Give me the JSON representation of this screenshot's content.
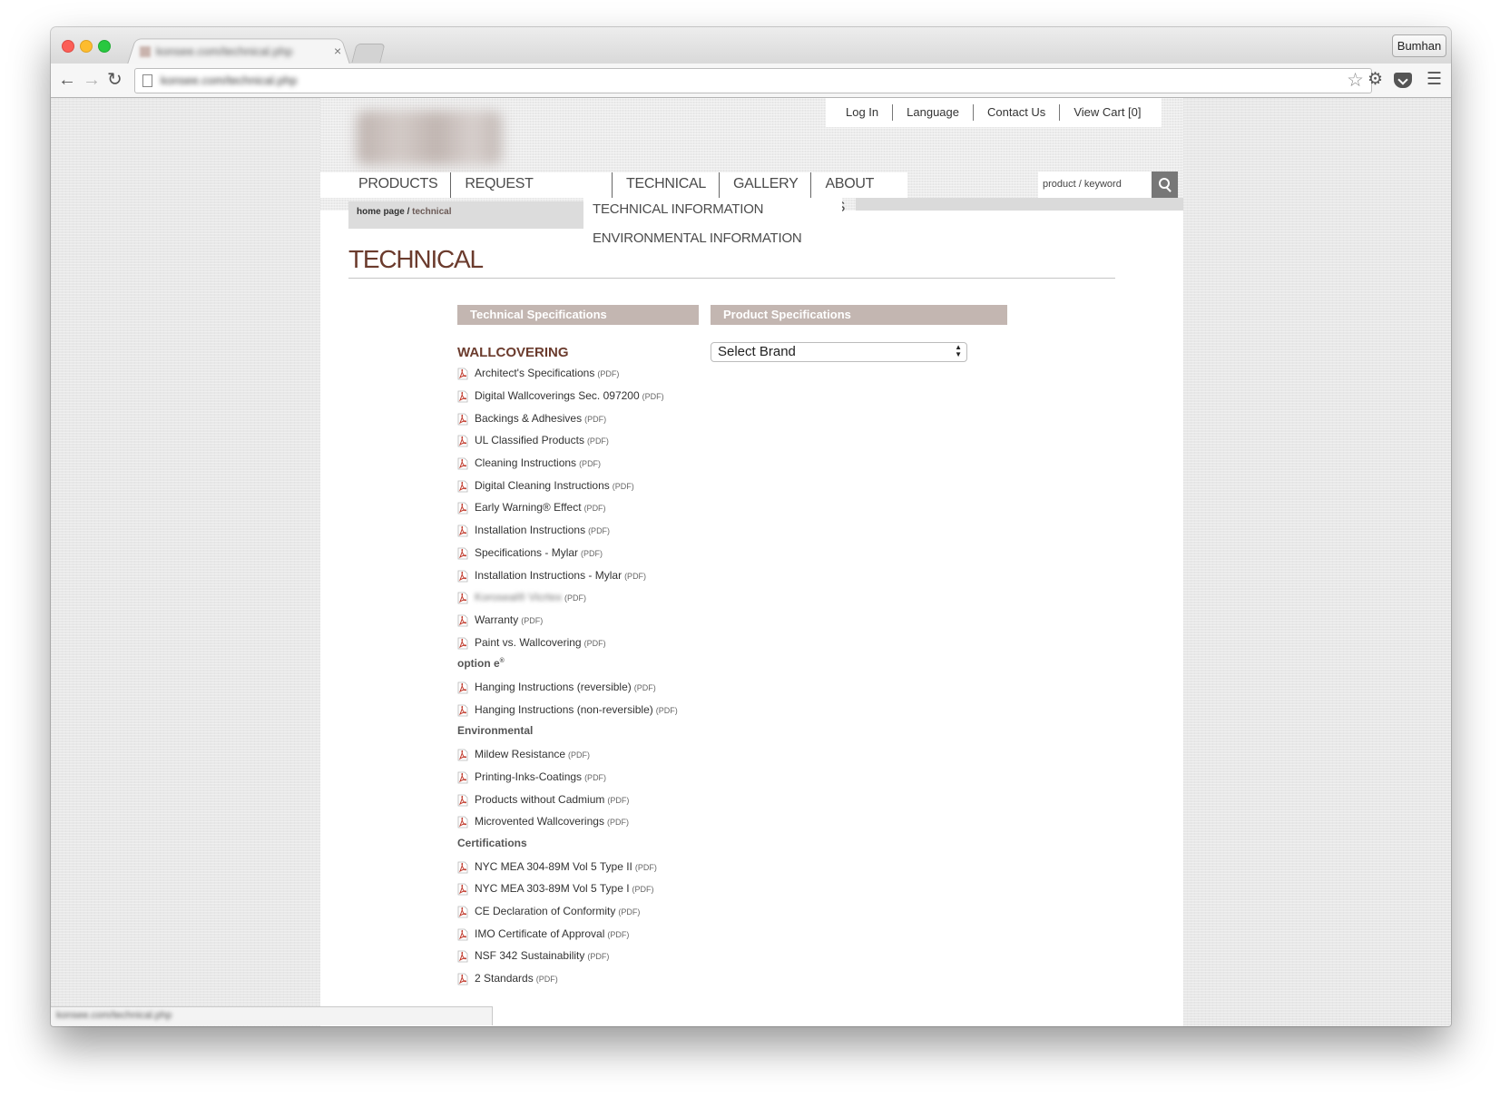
{
  "browser": {
    "tab_title": "konsee.com/technical.php",
    "tab_close": "×",
    "url": "konsee.com/technical.php",
    "profile_name": "Bumhan",
    "status_text": "konsee.com/technical.php",
    "icons": [
      "back-arrow-icon",
      "forward-arrow-icon",
      "reload-icon",
      "page-icon",
      "star-icon",
      "gear-icon",
      "pocket-icon",
      "menu-icon"
    ]
  },
  "utility_nav": {
    "login": "Log In",
    "language": "Language",
    "contact": "Contact Us",
    "cart": "View Cart [0]"
  },
  "main_nav": {
    "items": [
      "PRODUCTS",
      "REQUEST SAMPLES",
      "TECHNICAL",
      "GALLERY",
      "ABOUT US"
    ],
    "dropdown": [
      "TECHNICAL INFORMATION",
      "ENVIRONMENTAL INFORMATION"
    ]
  },
  "search": {
    "placeholder": "product / keyword"
  },
  "breadcrumb": {
    "home": "home page",
    "separator": "/",
    "current": "technical"
  },
  "page": {
    "title": "TECHNICAL",
    "tech_specs_header": "Technical Specifications",
    "product_specs_header": "Product Specifications",
    "select_brand": "Select Brand"
  },
  "pdf_label": "(PDF)",
  "wallcovering": {
    "heading": "WALLCOVERING",
    "docs": [
      "Architect's Specifications",
      "Digital Wallcoverings Sec. 097200",
      "Backings & Adhesives",
      "UL Classified Products",
      "Cleaning Instructions",
      "Digital Cleaning Instructions",
      "Early Warning® Effect",
      "Installation Instructions",
      "Specifications - Mylar",
      "Installation Instructions - Mylar",
      "Koroseal® Vicrtex",
      "Warranty",
      "Paint vs. Wallcovering"
    ]
  },
  "option_e": {
    "heading": "option e",
    "mark": "®",
    "docs": [
      "Hanging Instructions (reversible)",
      "Hanging Instructions (non-reversible)"
    ]
  },
  "environmental": {
    "heading": "Environmental",
    "docs": [
      "Mildew Resistance",
      "Printing-Inks-Coatings",
      "Products without Cadmium",
      "Microvented Wallcoverings"
    ]
  },
  "certifications": {
    "heading": "Certifications",
    "docs": [
      "NYC MEA 304-89M Vol 5 Type II",
      "NYC MEA 303-89M Vol 5 Type I",
      "CE Declaration of Conformity",
      "IMO Certificate of Approval",
      "NSF 342 Sustainability",
      "2 Standards"
    ]
  },
  "colors": {
    "accent_brown": "#6b3b2d",
    "section_header": "#c3b6b1",
    "pdf_red": "#c0392b"
  }
}
